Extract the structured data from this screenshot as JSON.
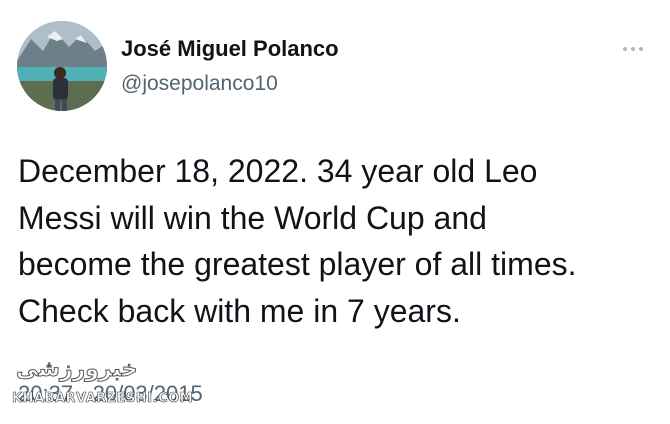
{
  "author": {
    "display_name": "José Miguel Polanco",
    "handle": "@josepolanco10",
    "avatar_icon": "profile-photo-mountain-lake"
  },
  "menu": {
    "icon": "more-horizontal-icon"
  },
  "tweet": {
    "text": "December 18, 2022. 34 year old Leo\nMessi will win the World Cup and\nbecome the greatest player of all times.\nCheck back with me in 7 years.",
    "timestamp": "20:37 · 20/03/2015"
  },
  "watermark": {
    "script_text": "خبرورزشی",
    "site_text": "KHABARVARZESHI.COM"
  },
  "colors": {
    "text_primary": "#0f1419",
    "text_secondary": "#536471",
    "background": "#ffffff"
  }
}
